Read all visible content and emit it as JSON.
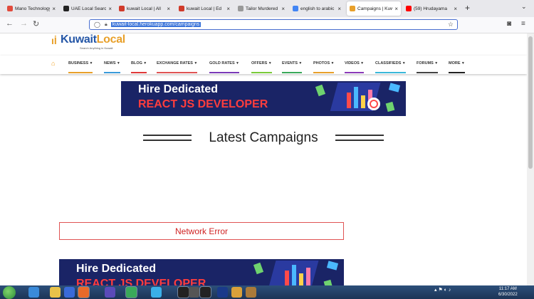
{
  "browser": {
    "tabs": [
      {
        "title": "Mano Technology",
        "color": "#e14a3c",
        "icon": "gmail-icon"
      },
      {
        "title": "UAE Local Search",
        "color": "#222222",
        "icon": "site-icon"
      },
      {
        "title": "kuwait Local | All",
        "color": "#d03a2a",
        "icon": "gmail-icon"
      },
      {
        "title": "kuwait Local | Ed",
        "color": "#d03a2a",
        "icon": "gmail-icon"
      },
      {
        "title": "Tailor Murdered",
        "color": "#999999",
        "icon": "page-icon"
      },
      {
        "title": "english to arabic",
        "color": "#4285f4",
        "icon": "google-icon"
      },
      {
        "title": "Campaigns | Kuw",
        "color": "#e8a02a",
        "icon": "kuwaitlocal-icon"
      },
      {
        "title": "(59) Hrudayama",
        "color": "#ff0000",
        "icon": "youtube-icon"
      }
    ],
    "url": "kuwait-local.herokuapp.com/campaigns"
  },
  "site": {
    "logo_text_1": "Kuwait",
    "logo_text_2": "Local",
    "tagline": "Search Anything in Kuwait",
    "menu": [
      {
        "label": "BUSINESS",
        "color": "#e8a02a"
      },
      {
        "label": "NEWS",
        "color": "#3a9ad9"
      },
      {
        "label": "BLOG",
        "color": "#e03a3a"
      },
      {
        "label": "EXCHANGE RATES",
        "color": "#e05454"
      },
      {
        "label": "GOLD RATES",
        "color": "#7a3ab8"
      },
      {
        "label": "OFFERS",
        "color": "#7acb3a"
      },
      {
        "label": "EVENTS",
        "color": "#3aa95a"
      },
      {
        "label": "PHOTOS",
        "color": "#e8a02a"
      },
      {
        "label": "VIDEOS",
        "color": "#8a3ab8"
      },
      {
        "label": "CLASSIFIEDS",
        "color": "#3ab8d9"
      },
      {
        "label": "FORUMS",
        "color": "#444444"
      },
      {
        "label": "MORE",
        "color": "#222222"
      }
    ]
  },
  "banner": {
    "line1": "Hire Dedicated",
    "line2": "REACT JS DEVELOPER"
  },
  "headline": "Latest Campaigns",
  "error": "Network Error",
  "taskbar": {
    "apps": [
      {
        "icon": "ie-icon",
        "color": "#3a8ad9"
      },
      {
        "icon": "folder-icon",
        "color": "#e8c24a"
      },
      {
        "icon": "media-player-icon",
        "color": "#3a6ad9"
      },
      {
        "icon": "firefox-icon",
        "color": "#e86a2a"
      },
      {
        "icon": "firefox-dev-icon",
        "color": "#5a4ab8"
      },
      {
        "icon": "chrome-icon",
        "color": "#3aa95a"
      },
      {
        "icon": "skype-icon",
        "color": "#3ab0e8"
      },
      {
        "icon": "terminal-icon",
        "color": "#222222"
      },
      {
        "icon": "sublime-icon",
        "color": "#555555"
      },
      {
        "icon": "terminal-icon",
        "color": "#222222"
      },
      {
        "icon": "photoshop-icon",
        "color": "#1a3a8a"
      },
      {
        "icon": "files-icon",
        "color": "#d9a03a"
      },
      {
        "icon": "paint-icon",
        "color": "#aa7a3a"
      }
    ],
    "time": "11:17 AM",
    "date": "6/30/2022"
  }
}
